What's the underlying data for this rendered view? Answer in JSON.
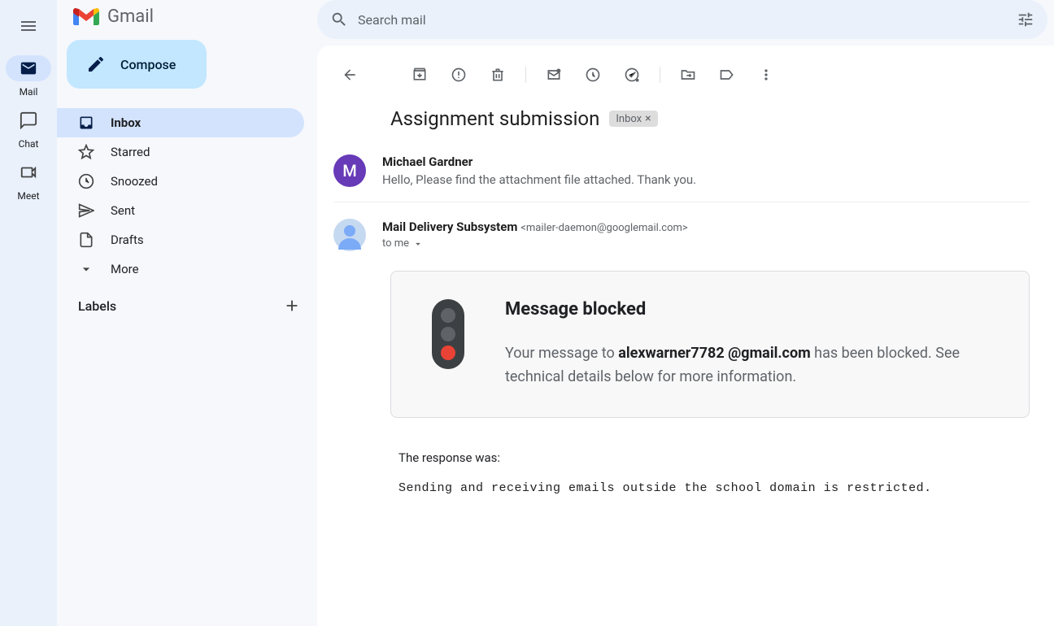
{
  "app_name": "Gmail",
  "search_placeholder": "Search mail",
  "rail": {
    "mail": "Mail",
    "chat": "Chat",
    "meet": "Meet"
  },
  "compose_label": "Compose",
  "nav": {
    "inbox": "Inbox",
    "starred": "Starred",
    "snoozed": "Snoozed",
    "sent": "Sent",
    "drafts": "Drafts",
    "more": "More"
  },
  "labels_title": "Labels",
  "subject": "Assignment submission",
  "label_chip": "Inbox",
  "message1": {
    "sender": "Michael Gardner",
    "avatar_letter": "M",
    "snippet": "Hello, Please find the attachment file attached. Thank you."
  },
  "message2": {
    "sender": "Mail Delivery Subsystem",
    "email": "<mailer-daemon@googlemail.com>",
    "to": "to me"
  },
  "block": {
    "title": "Message blocked",
    "desc_before": "Your message to ",
    "email": "alexwarner7782 @gmail.com",
    "desc_after": " has been blocked. See technical details below for more information."
  },
  "response": {
    "label": "The response was:",
    "text": "Sending and receiving emails outside the school domain is restricted."
  }
}
